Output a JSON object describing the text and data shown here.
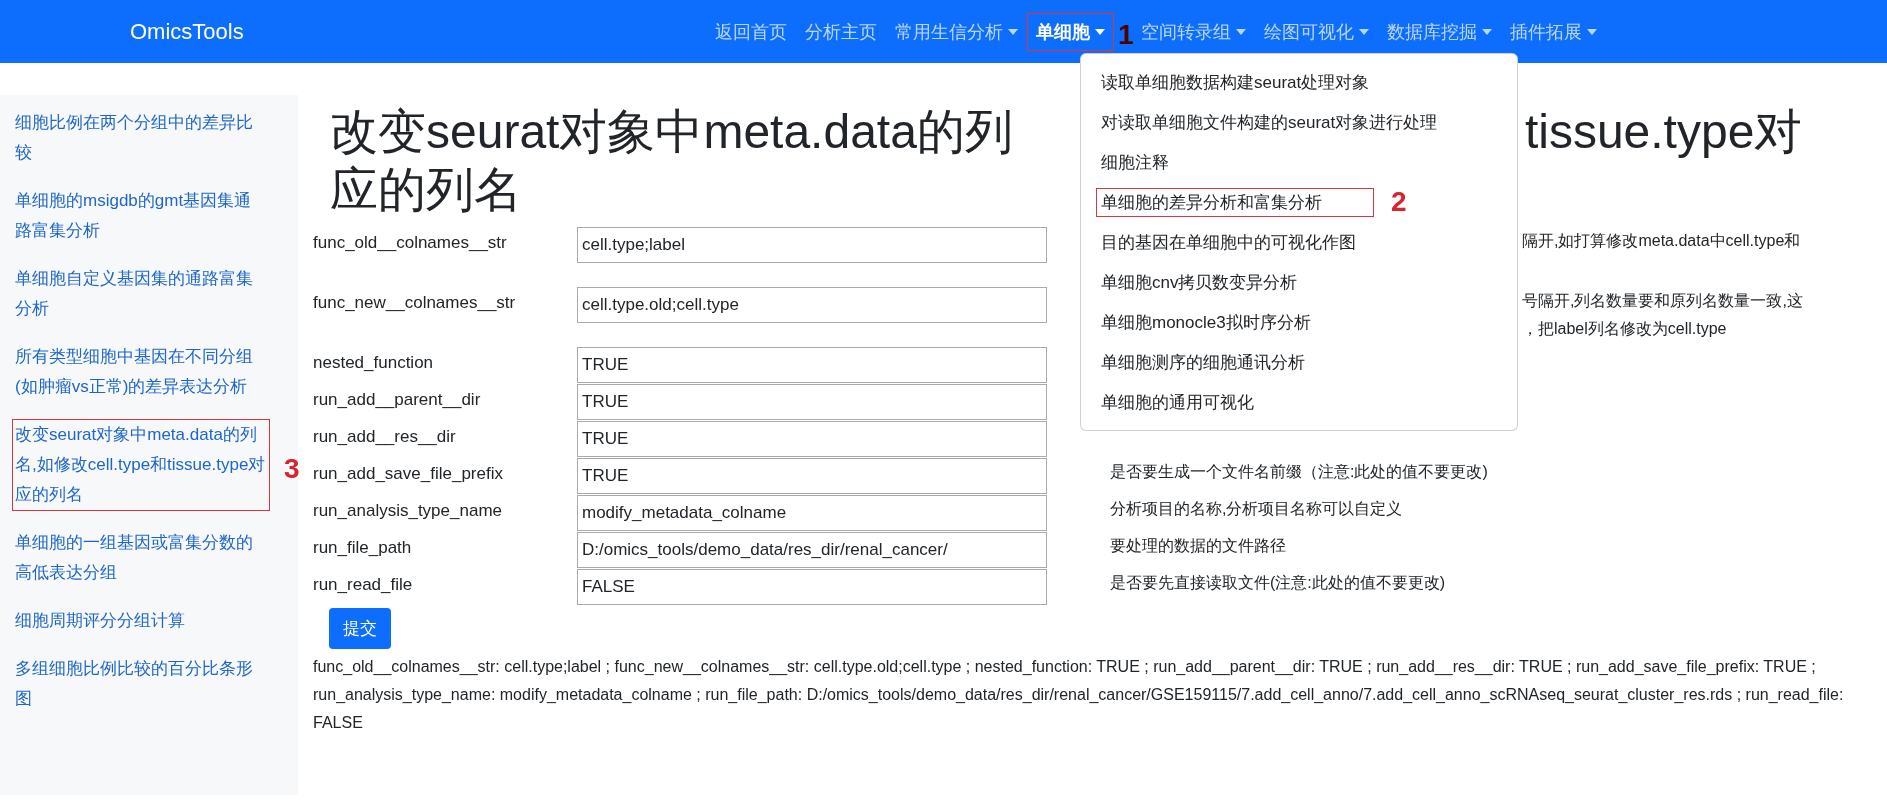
{
  "navbar": {
    "brand": "OmicsTools",
    "items": [
      {
        "label": "返回首页",
        "dropdown": false,
        "selected": false,
        "highlighted": false
      },
      {
        "label": "分析主页",
        "dropdown": false,
        "selected": false,
        "highlighted": false
      },
      {
        "label": "常用生信分析",
        "dropdown": true,
        "selected": false,
        "highlighted": false
      },
      {
        "label": "单细胞",
        "dropdown": true,
        "selected": true,
        "highlighted": true,
        "marker": "1"
      },
      {
        "label": "空间转录组",
        "dropdown": true,
        "selected": false,
        "highlighted": false
      },
      {
        "label": "绘图可视化",
        "dropdown": true,
        "selected": false,
        "highlighted": false
      },
      {
        "label": "数据库挖掘",
        "dropdown": true,
        "selected": false,
        "highlighted": false
      },
      {
        "label": "插件拓展",
        "dropdown": true,
        "selected": false,
        "highlighted": false
      }
    ]
  },
  "dropdown_menu": {
    "items": [
      {
        "label": "读取单细胞数据构建seurat处理对象",
        "highlighted": false
      },
      {
        "label": "对读取单细胞文件构建的seurat对象进行处理",
        "highlighted": false
      },
      {
        "label": "细胞注释",
        "highlighted": false
      },
      {
        "label": "单细胞的差异分析和富集分析",
        "highlighted": true,
        "marker": "2"
      },
      {
        "label": "目的基因在单细胞中的可视化作图",
        "highlighted": false
      },
      {
        "label": "单细胞cnv拷贝数变异分析",
        "highlighted": false
      },
      {
        "label": "单细胞monocle3拟时序分析",
        "highlighted": false
      },
      {
        "label": "单细胞测序的细胞通讯分析",
        "highlighted": false
      },
      {
        "label": "单细胞的通用可视化",
        "highlighted": false
      }
    ]
  },
  "sidebar": {
    "items": [
      {
        "label": "细胞比例在两个分组中的差异比较",
        "highlighted": false
      },
      {
        "label": "单细胞的msigdb的gmt基因集通路富集分析",
        "highlighted": false
      },
      {
        "label": "单细胞自定义基因集的通路富集分析",
        "highlighted": false
      },
      {
        "label": "所有类型细胞中基因在不同分组(如肿瘤vs正常)的差异表达分析",
        "highlighted": false
      },
      {
        "label": "改变seurat对象中meta.data的列名,如修改cell.type和tissue.type对应的列名",
        "highlighted": true,
        "marker": "3"
      },
      {
        "label": "单细胞的一组基因或富集分数的高低表达分组",
        "highlighted": false
      },
      {
        "label": "细胞周期评分分组计算",
        "highlighted": false
      },
      {
        "label": "多组细胞比例比较的百分比条形图",
        "highlighted": false
      }
    ]
  },
  "page_title": {
    "line_1_left": "改变seurat对象中meta.data的列",
    "line_1_right": "tissue.type对",
    "line_2": "应的列名"
  },
  "form": {
    "fields": [
      {
        "label": "func_old__colnames__str",
        "value": "cell.type;label",
        "tall": true,
        "description": {
          "covered": true,
          "lines": [
            "隔开,如打算修改meta.data中cell.type和"
          ]
        }
      },
      {
        "label": "func_new__colnames__str",
        "value": "cell.type.old;cell.type",
        "tall": true,
        "description": {
          "covered": true,
          "lines": [
            "号隔开,列名数量要和原列名数量一致,这",
            "，把label列名修改为cell.type"
          ]
        }
      },
      {
        "label": "nested_function",
        "value": "TRUE",
        "tall": false
      },
      {
        "label": "run_add__parent__dir",
        "value": "TRUE",
        "tall": false
      },
      {
        "label": "run_add__res__dir",
        "value": "TRUE",
        "tall": false
      },
      {
        "label": "run_add_save_file_prefix",
        "value": "TRUE",
        "tall": false,
        "description": {
          "covered": false,
          "lines": [
            "是否要生成一个文件名前缀（注意:此处的值不要更改)"
          ]
        }
      },
      {
        "label": "run_analysis_type_name",
        "value": "modify_metadata_colname",
        "tall": false,
        "description": {
          "covered": false,
          "lines": [
            "分析项目的名称,分析项目名称可以自定义"
          ]
        }
      },
      {
        "label": "run_file_path",
        "value": "D:/omics_tools/demo_data/res_dir/renal_cancer/",
        "tall": false,
        "description": {
          "covered": false,
          "lines": [
            "要处理的数据的文件路径"
          ]
        }
      },
      {
        "label": "run_read_file",
        "value": "FALSE",
        "tall": false,
        "description": {
          "covered": false,
          "lines": [
            "是否要先直接读取文件(注意:此处的值不要更改)"
          ]
        }
      }
    ],
    "submit": "提交"
  },
  "summary": "func_old__colnames__str: cell.type;label ; func_new__colnames__str: cell.type.old;cell.type ; nested_function: TRUE ; run_add__parent__dir: TRUE ; run_add__res__dir: TRUE ; run_add_save_file_prefix: TRUE ; run_analysis_type_name: modify_metadata_colname ; run_file_path: D:/omics_tools/demo_data/res_dir/renal_cancer/GSE159115/7.add_cell_anno/7.add_cell_anno_scRNAseq_seurat_cluster_res.rds ; run_read_file: FALSE"
}
